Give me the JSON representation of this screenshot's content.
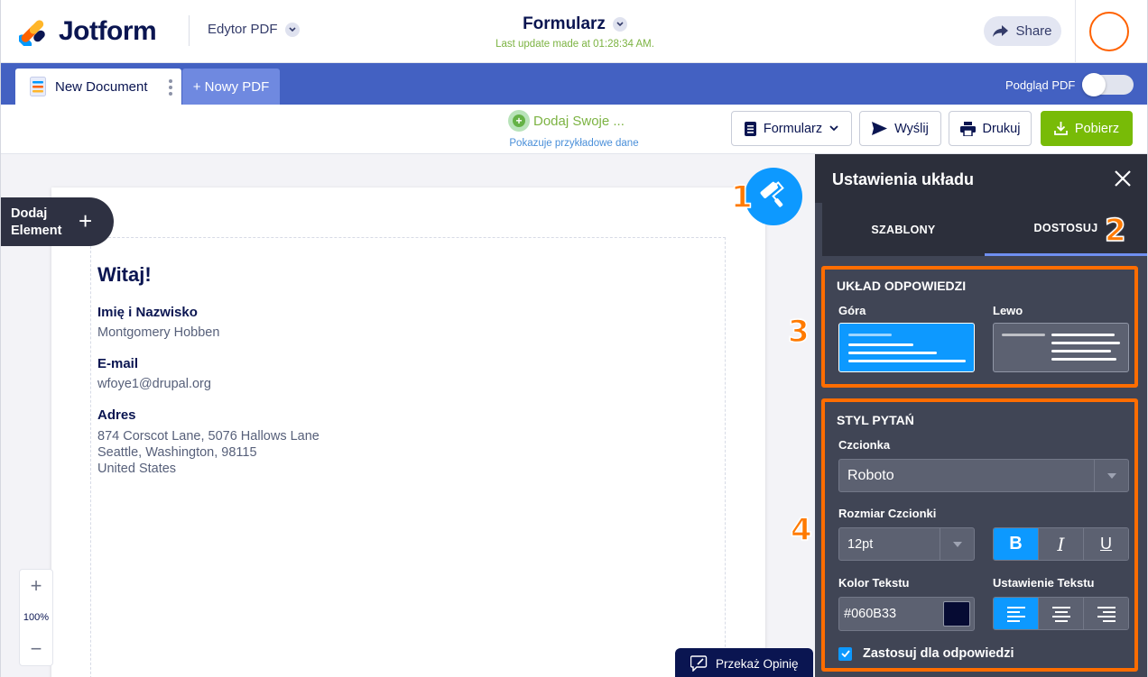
{
  "header": {
    "logo_text": "Jotform",
    "editor_mode": "Edytor PDF",
    "form_title": "Formularz",
    "last_update": "Last update made at 01:28:34 AM.",
    "share_label": "Share"
  },
  "tabs": {
    "document_tab": "New Document",
    "new_pdf": "+ Nowy PDF",
    "preview_label": "Podgląd PDF",
    "preview_on": false
  },
  "toolbar": {
    "add_yours": "Dodaj Swoje ...",
    "sample_note": "Pokazuje przykładowe dane",
    "formularz": "Formularz",
    "send": "Wyślij",
    "print": "Drukuj",
    "download": "Pobierz"
  },
  "canvas": {
    "add_element_line1": "Dodaj",
    "add_element_line2": "Element",
    "welcome": "Witaj!",
    "fields": [
      {
        "label": "Imię i Nazwisko",
        "value": "Montgomery Hobben"
      },
      {
        "label": "E-mail",
        "value": "wfoye1@drupal.org"
      },
      {
        "label": "Adres",
        "value_lines": [
          "874 Corscot Lane, 5076 Hallows Lane",
          "Seattle, Washington, 98115",
          "United States"
        ]
      }
    ],
    "zoom_in": "+",
    "zoom_level": "100%",
    "zoom_out": "−",
    "feedback": "Przekaż Opinię"
  },
  "callouts": [
    "1",
    "2",
    "3",
    "4"
  ],
  "panel": {
    "title": "Ustawienia układu",
    "tab_templates": "SZABLONY",
    "tab_customize": "DOSTOSUJ",
    "answer_layout": {
      "heading": "UKŁAD ODPOWIEDZI",
      "top_label": "Góra",
      "left_label": "Lewo",
      "selected": "Góra"
    },
    "question_style": {
      "heading": "STYL PYTAŃ",
      "font_label": "Czcionka",
      "font_value": "Roboto",
      "size_label": "Rozmiar Czcionki",
      "size_value": "12pt",
      "bold": "B",
      "italic": "I",
      "underline": "U",
      "color_label": "Kolor Tekstu",
      "color_value": "#060B33",
      "align_label": "Ustawienie Tekstu",
      "apply_label": "Zastosuj dla odpowiedzi",
      "apply_checked": true
    }
  },
  "colors": {
    "brand_blue": "#4361c2",
    "accent_orange": "#ff6d00",
    "green": "#78bb07",
    "selected_blue": "#0d99ff",
    "text_color_swatch": "#060B33"
  }
}
